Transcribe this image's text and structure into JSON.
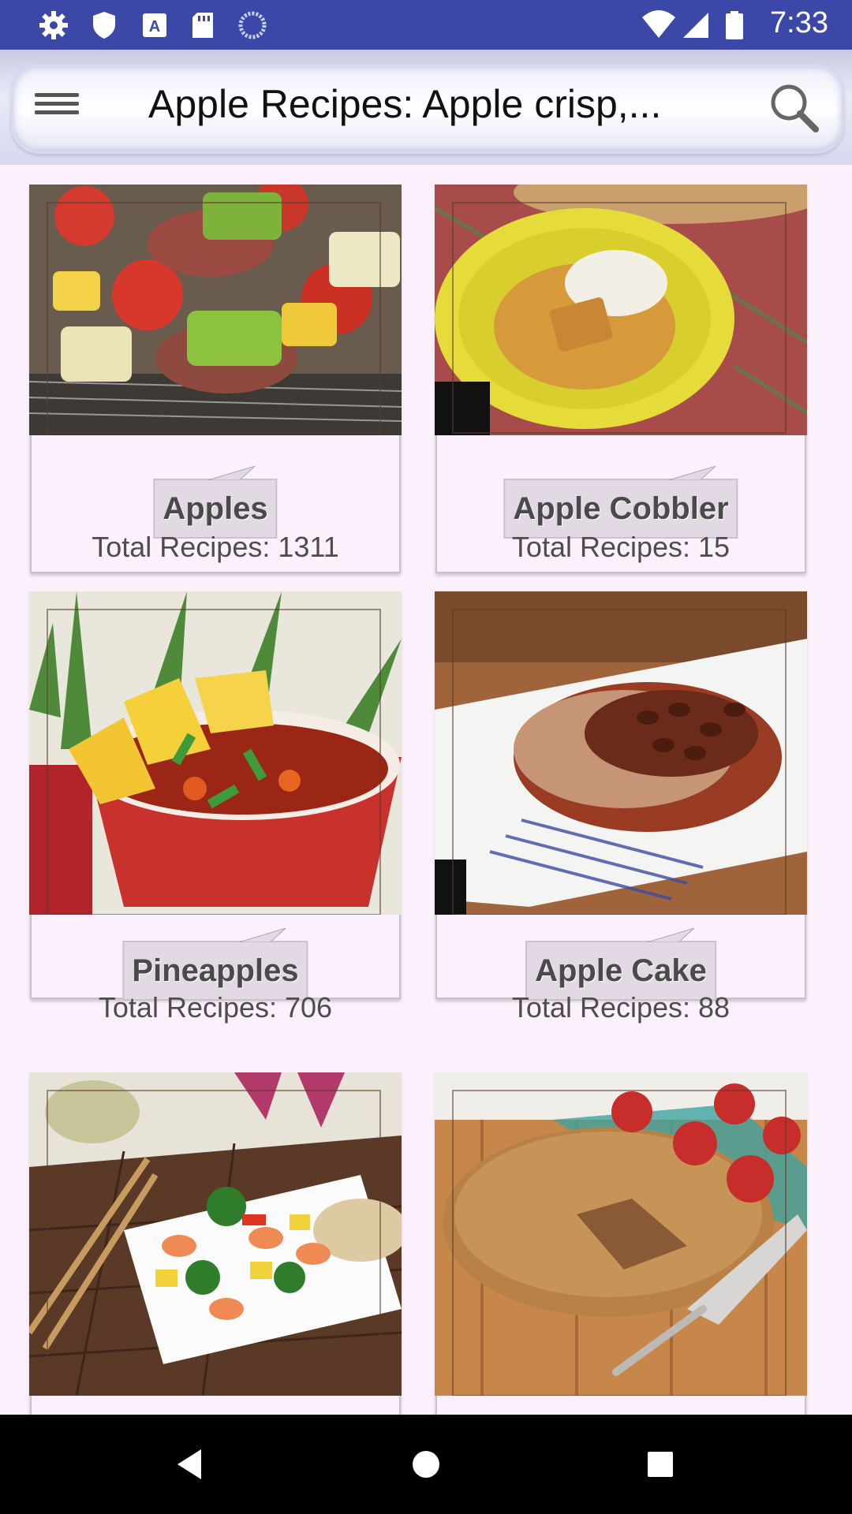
{
  "status_bar": {
    "time": "7:33",
    "left_icons": [
      "gear-icon",
      "shield-icon",
      "font-a-icon",
      "sd-card-icon",
      "loading-icon"
    ],
    "right_icons": [
      "wifi-icon",
      "signal-icon",
      "battery-icon"
    ]
  },
  "toolbar": {
    "title": "Apple Recipes: Apple crisp,...",
    "menu_icon": "hamburger-menu-icon",
    "search_icon": "search-icon"
  },
  "categories": [
    {
      "name": "Apples",
      "count": "Total Recipes: 1311",
      "image": "grilled-kabobs"
    },
    {
      "name": "Apple Cobbler",
      "count": "Total Recipes: 15",
      "image": "cobbler-bowl"
    },
    {
      "name": "Pineapples",
      "count": "Total Recipes: 706",
      "image": "pineapple-sweet-sour"
    },
    {
      "name": "Apple Cake",
      "count": "Total Recipes: 88",
      "image": "pecan-pork-chop"
    },
    {
      "name": "",
      "count": "",
      "image": "shrimp-stir-fry"
    },
    {
      "name": "",
      "count": "",
      "image": "apple-coffee-cake"
    }
  ],
  "nav_bar": {
    "back_icon": "back-triangle-icon",
    "home_icon": "home-circle-icon",
    "recents_icon": "recents-square-icon"
  }
}
